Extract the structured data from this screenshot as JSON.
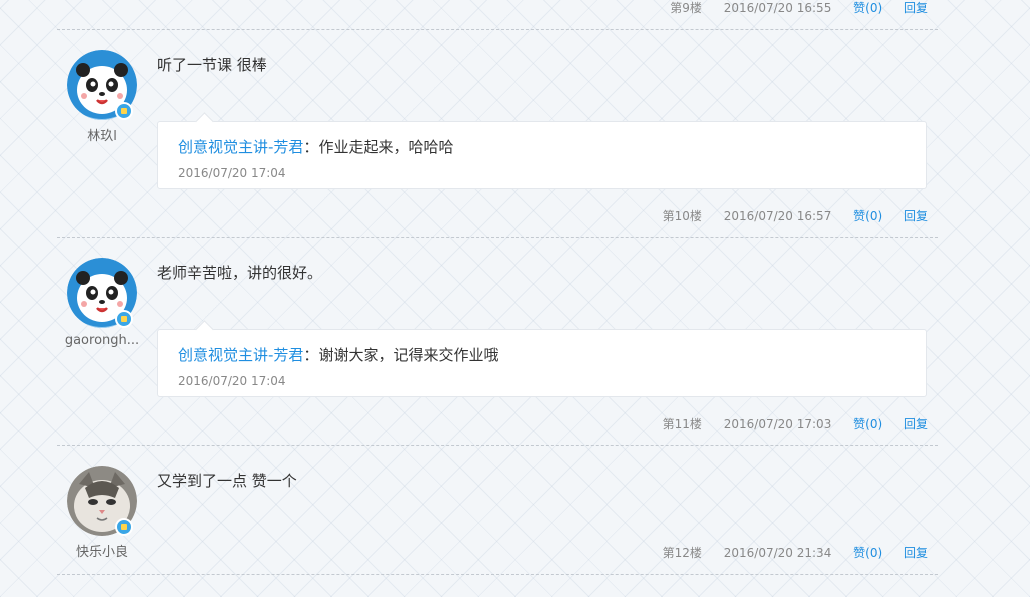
{
  "top_meta": {
    "floor": "第9楼",
    "date": "2016/07/20 16:55",
    "like": "赞(0)",
    "reply": "回复"
  },
  "posts": [
    {
      "username": "林玖l",
      "avatar": "panda-avatar",
      "content": "听了一节课 很棒",
      "reply": {
        "author": "创意视觉主讲-芳君",
        "sep": "：",
        "text": "作业走起来，哈哈哈",
        "time": "2016/07/20 17:04"
      },
      "meta": {
        "floor": "第10楼",
        "date": "2016/07/20 16:57",
        "like": "赞(0)",
        "reply": "回复"
      }
    },
    {
      "username": "gaorongh...",
      "avatar": "panda-avatar",
      "content": "老师辛苦啦，讲的很好。",
      "reply": {
        "author": "创意视觉主讲-芳君",
        "sep": "：",
        "text": "谢谢大家，记得来交作业哦",
        "time": "2016/07/20 17:04"
      },
      "meta": {
        "floor": "第11楼",
        "date": "2016/07/20 17:03",
        "like": "赞(0)",
        "reply": "回复"
      }
    },
    {
      "username": "快乐小良",
      "avatar": "kitten-photo-avatar",
      "content": "又学到了一点  赞一个",
      "meta": {
        "floor": "第12楼",
        "date": "2016/07/20 21:34",
        "like": "赞(0)",
        "reply": "回复"
      }
    }
  ],
  "colors": {
    "link": "#1f8ee0",
    "meta": "#888888",
    "divider": "#c3c9d0",
    "badge": "#3aa6e6"
  }
}
